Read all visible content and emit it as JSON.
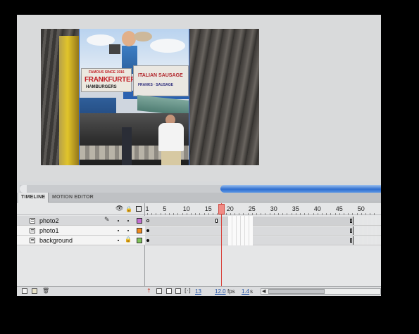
{
  "panel_tabs": {
    "timeline": "TIMELINE",
    "motion_editor": "MOTION EDITOR"
  },
  "header_icons": {
    "eye": "eye-icon",
    "lock": "lock-icon",
    "outline": "outline-icon"
  },
  "ruler": {
    "labels": [
      "1",
      "5",
      "10",
      "15",
      "20",
      "25",
      "30",
      "35",
      "40",
      "45",
      "50"
    ],
    "current_frame": 18
  },
  "layers": [
    {
      "name": "photo2",
      "color": "#c36fd0",
      "selected": true,
      "editing": true,
      "locked": false
    },
    {
      "name": "photo1",
      "color": "#f08a1e",
      "selected": false,
      "editing": false,
      "locked": false
    },
    {
      "name": "background",
      "color": "#7fc25a",
      "selected": false,
      "editing": false,
      "locked": true
    }
  ],
  "footer": {
    "current_frame": "13",
    "fps_value": "12.0",
    "fps_unit": "fps",
    "elapsed_value": "1.4",
    "elapsed_unit": "s"
  },
  "stage_signs": {
    "frankfurters": "FRANKFURTERS",
    "hamburgers": "HAMBURGERS",
    "famous": "FAMOUS SINCE 1916",
    "italian": "ITALIAN SAUSAGE",
    "italian_sub": "FRANKS · SAUSAGE"
  },
  "colors": {
    "playhead": "#d8413a",
    "accent_blue": "#2f6fd0"
  }
}
